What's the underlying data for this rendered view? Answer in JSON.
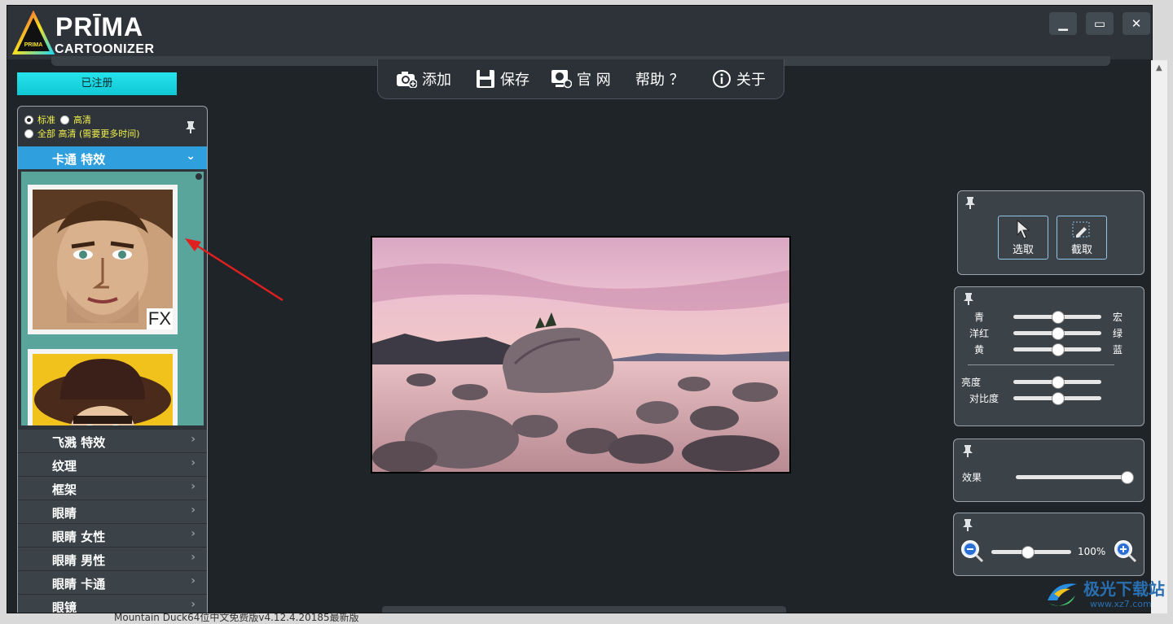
{
  "app": {
    "logo_top": "PRĪMA",
    "logo_bottom": "CARTOONIZER",
    "logo_badge": "PRIMA",
    "window_minimize": "▁",
    "window_maximize": "▭",
    "window_close": "✕"
  },
  "toolbar": {
    "add": "添加",
    "save": "保存",
    "website": "官 网",
    "help": "帮助 ？",
    "about": "关于"
  },
  "left": {
    "registered": "已注册",
    "quality_standard": "标准",
    "quality_hd": "高清",
    "quality_all_hd": "全部 高清 (需要更多时间)",
    "active_category": "卡通 特效",
    "fx_badge": "FX",
    "categories": [
      "飞溅 特效",
      "纹理",
      "框架",
      "眼睛",
      "眼睛 女性",
      "眼睛 男性",
      "眼睛 卡通",
      "眼镜"
    ]
  },
  "tools": {
    "select": "选取",
    "crop": "截取"
  },
  "color": {
    "cyan": "青",
    "red": "宏",
    "magenta": "洋红",
    "green": "绿",
    "yellow": "黄",
    "blue": "蓝",
    "brightness": "亮度",
    "contrast": "对比度",
    "values": {
      "cyan_red": 0.5,
      "magenta_green": 0.5,
      "yellow_blue": 0.5,
      "brightness": 0.5,
      "contrast": 0.5
    }
  },
  "effect": {
    "label": "效果",
    "value": 1.0
  },
  "zoom": {
    "value_label": "100%",
    "value": 0.45
  },
  "background": {
    "watermark_text": "极光下载站",
    "watermark_url": "www.xz7.com",
    "bottom_text": "Mountain Duck64位中文免费版v4.12.4.20185最新版"
  },
  "colors": {
    "accent_cyan": "#16d6e0",
    "category_active": "#2fa0dd",
    "thumbs_bg": "#5aa59b",
    "arrow": "#e02020"
  }
}
